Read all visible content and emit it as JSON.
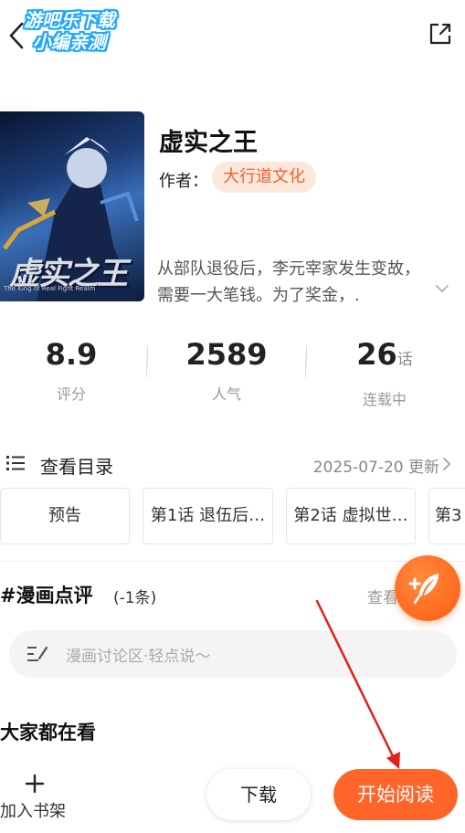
{
  "watermark": {
    "line1": "游吧乐下载",
    "line2": "小编亲测"
  },
  "book": {
    "title": "虚实之王",
    "author_label": "作者：",
    "author_name": "大行道文化",
    "description": "从部队退役后，李元宰家发生变故，需要一大笔钱。为了奖金，.",
    "cover": {
      "title_text": "虚实之王",
      "subtitle_text": "The King of Real Fight Realm"
    }
  },
  "stats": [
    {
      "value": "8.9",
      "unit": "",
      "label": "评分"
    },
    {
      "value": "2589",
      "unit": "",
      "label": "人气"
    },
    {
      "value": "26",
      "unit": "话",
      "label": "连载中"
    }
  ],
  "catalog": {
    "label": "查看目录",
    "update": "2025-07-20 更新"
  },
  "chapters": [
    "预告",
    "第1话 退伍后…",
    "第2话 虚拟世…",
    "第3"
  ],
  "reviews": {
    "title": "#漫画点评",
    "count": "(-1条)",
    "more": "查看"
  },
  "comment": {
    "placeholder": "漫画讨论区·轻点说～"
  },
  "popular": {
    "title": "大家都在看"
  },
  "bottom_bar": {
    "shelf_label": "加入书架",
    "download_label": "下载",
    "read_label": "开始阅读"
  },
  "colors": {
    "accent": "#ff6428",
    "author_tag_bg": "#fde8dc",
    "author_tag_text": "#f0612d",
    "annotation_arrow": "#e0201b"
  }
}
